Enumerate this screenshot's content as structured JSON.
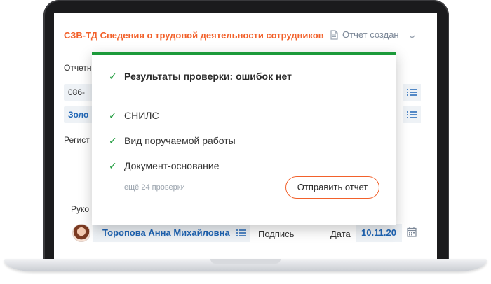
{
  "header": {
    "title": "СЗВ-ТД Сведения о трудовой деятельности сотрудников",
    "status": "Отчет создан"
  },
  "form": {
    "partial_label_1": "Отчетн",
    "partial_field_1": "086-",
    "partial_field_2": "Золо",
    "partial_label_2": "Регист",
    "partial_label_3": "Руко"
  },
  "signer": {
    "name": "Торопова Анна Михайловна",
    "signature_label": "Подпись",
    "date_label": "Дата",
    "date_value": "10.11.20"
  },
  "popup": {
    "title": "Результаты проверки: ошибок нет",
    "checks": [
      "СНИЛС",
      "Вид поручаемой работы",
      "Документ-основание"
    ],
    "more": "ещё 24 проверки",
    "send_button": "Отправить отчет"
  },
  "colors": {
    "accent": "#f2612b",
    "success": "#1c9a3a",
    "link_blue": "#1f65b5",
    "field_bg": "#eef2f6"
  }
}
